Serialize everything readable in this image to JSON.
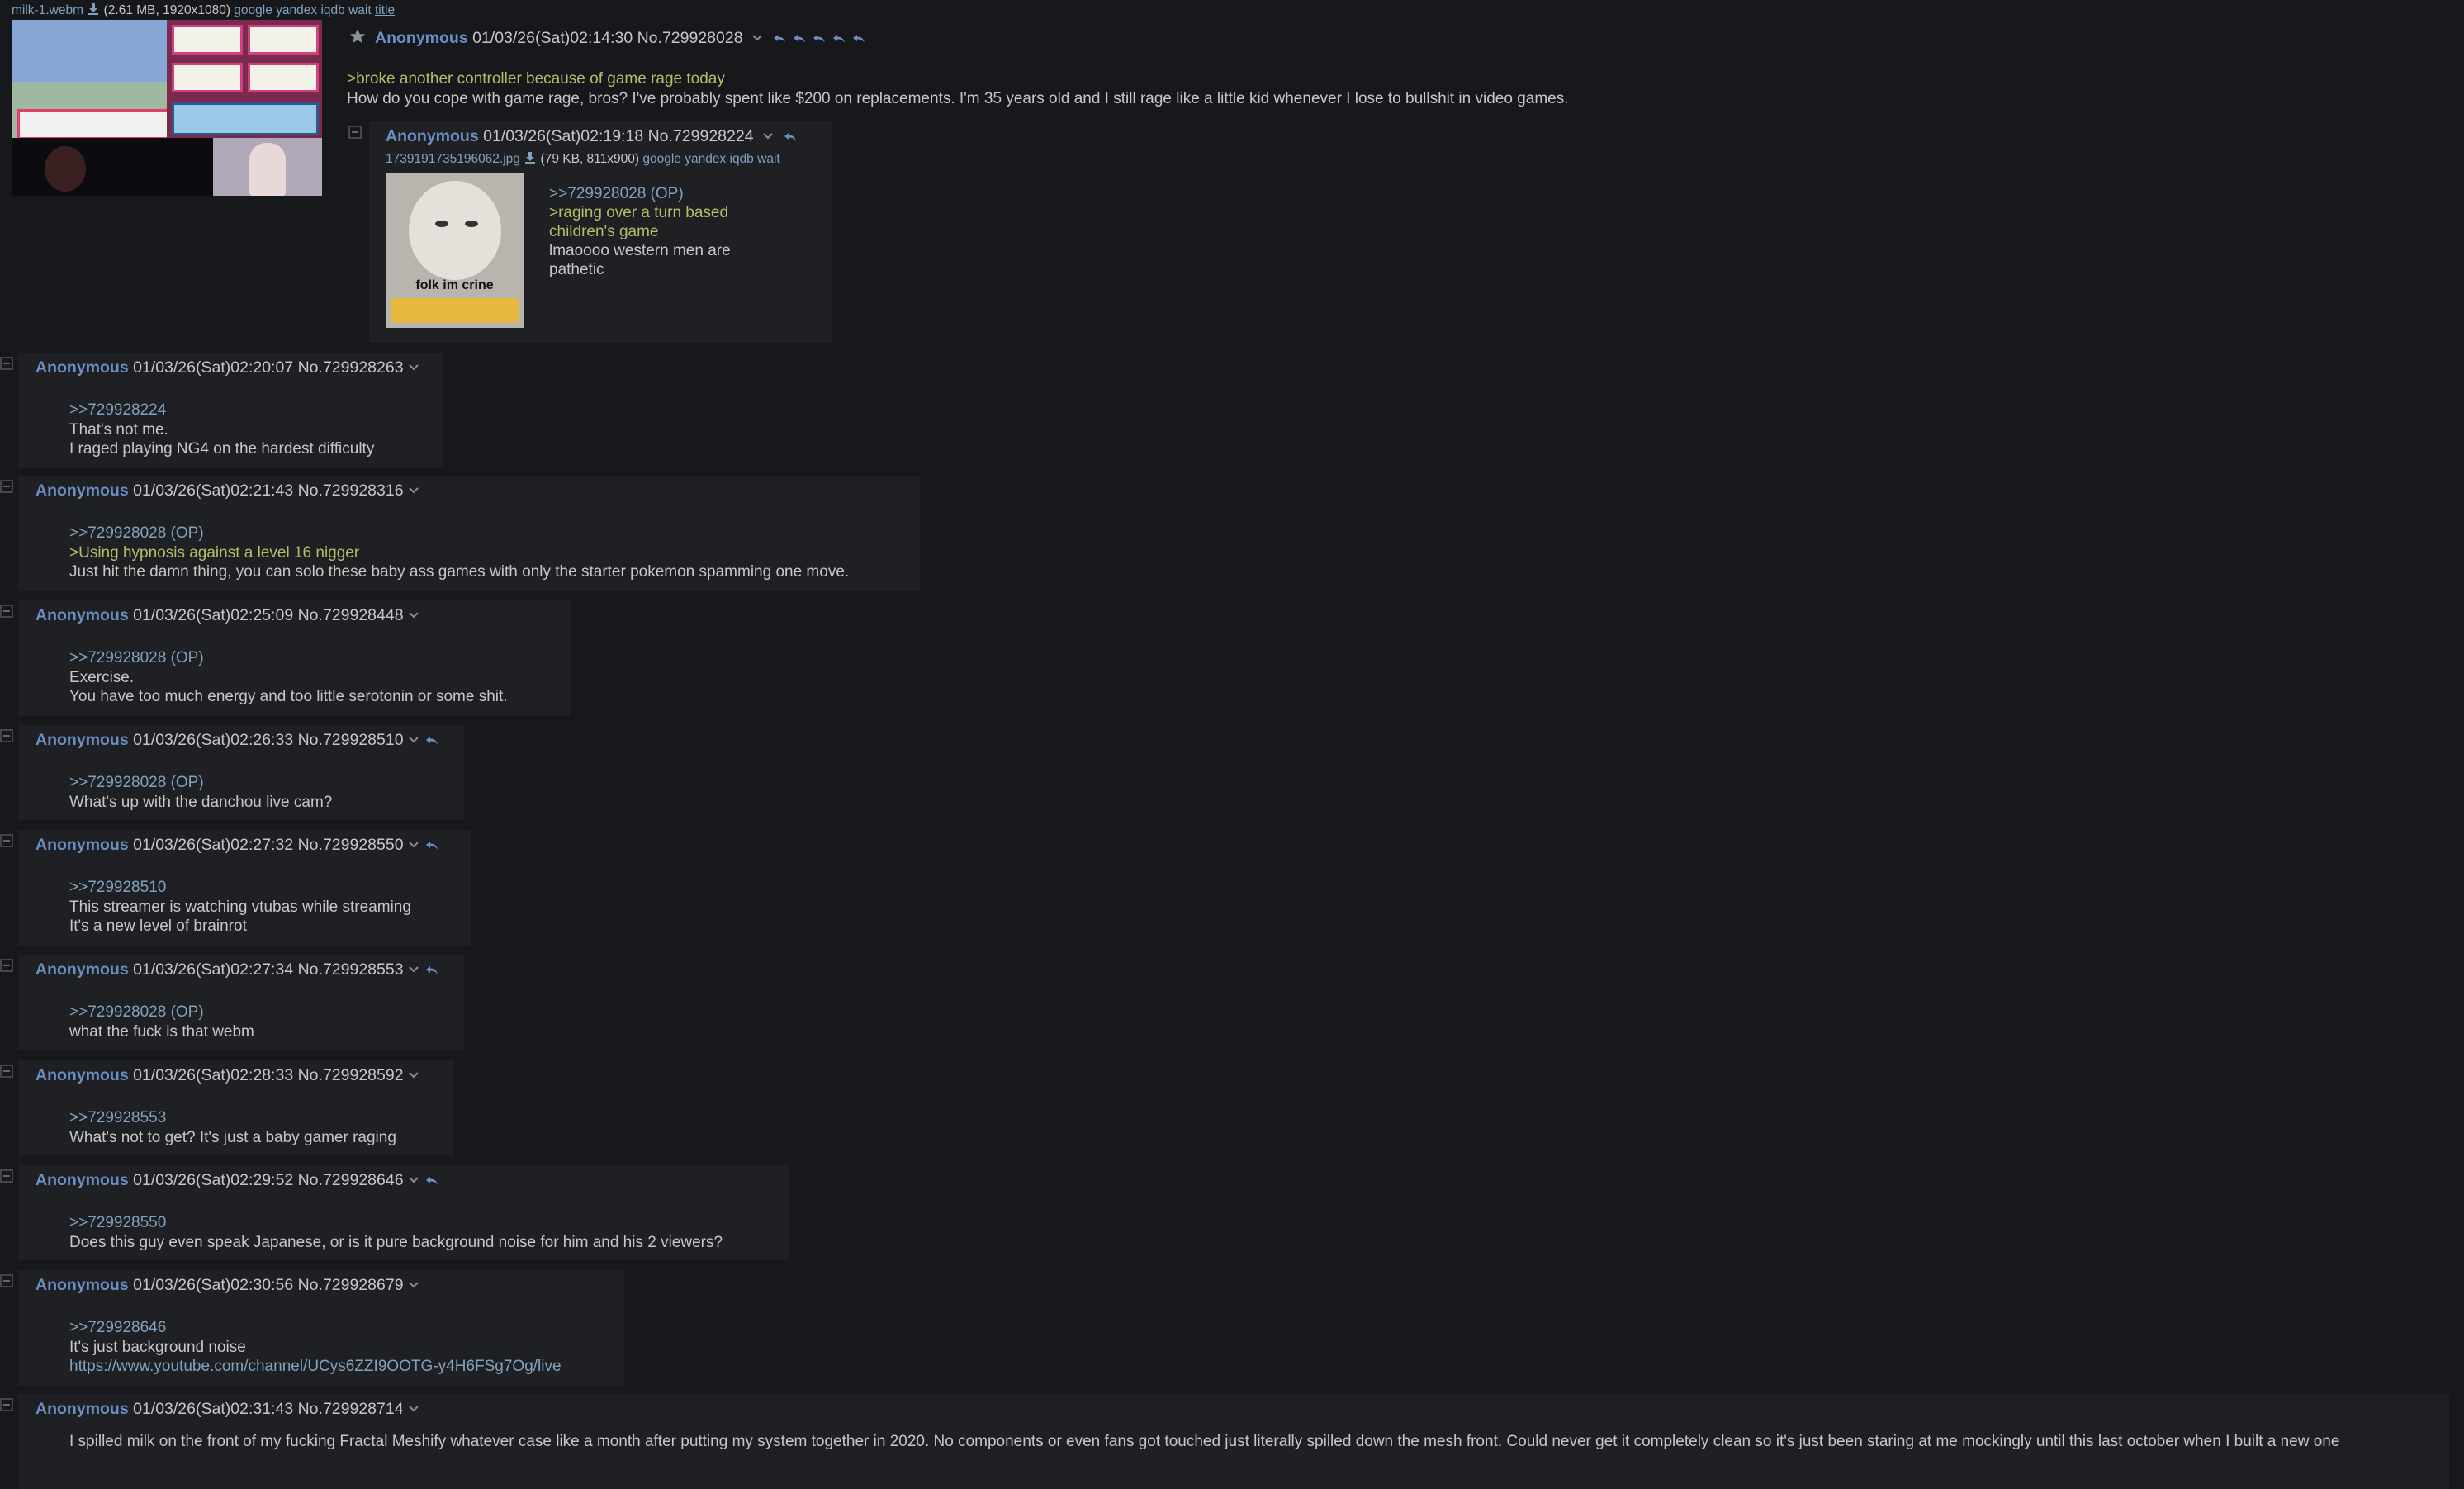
{
  "op": {
    "file": {
      "name": "milk-1.webm",
      "meta": "(2.61 MB, 1920x1080)",
      "services": [
        "google",
        "yandex",
        "iqdb",
        "wait"
      ],
      "title_link": "title"
    },
    "name": "Anonymous",
    "datetime": "01/03/26(Sat)02:14:30",
    "post_no": "No.729928028",
    "lines": [
      {
        "text": ">broke another controller because of game rage today",
        "kind": "quote"
      },
      {
        "text": "How do you cope with game rage, bros? I've probably spent like $200 on replacements. I'm 35 years old and I still rage like a little kid whenever I lose to bullshit in video games.",
        "kind": "text"
      }
    ]
  },
  "nested": {
    "name": "Anonymous",
    "datetime": "01/03/26(Sat)02:19:18",
    "post_no": "No.729928224",
    "file_name": "1739191735196062.jpg",
    "file_meta": "(79 KB, 811x900)",
    "services": [
      "google",
      "yandex",
      "iqdb",
      "wait"
    ],
    "thumb_caption": "folk im crine",
    "lines": [
      {
        "text": ">>729928028 (OP)",
        "kind": "link"
      },
      {
        "text": ">raging over a turn based",
        "kind": "quote"
      },
      {
        "text": "children's game",
        "kind": "quote"
      },
      {
        "text": "lmaoooo western men are",
        "kind": "text"
      },
      {
        "text": "pathetic",
        "kind": "text"
      }
    ]
  },
  "replies": [
    {
      "datetime": "01/03/26(Sat)02:20:07",
      "post_no": "No.729928263",
      "reply_icon": false,
      "lines": [
        {
          "text": ">>729928224",
          "kind": "link"
        },
        {
          "text": "That's not me.",
          "kind": "text"
        },
        {
          "text": "I raged playing NG4 on the hardest difficulty",
          "kind": "text"
        }
      ]
    },
    {
      "datetime": "01/03/26(Sat)02:21:43",
      "post_no": "No.729928316",
      "reply_icon": false,
      "lines": [
        {
          "text": ">>729928028 (OP)",
          "kind": "link"
        },
        {
          "text": ">Using hypnosis against a level 16 nigger",
          "kind": "quote"
        },
        {
          "text": "Just hit the damn thing, you can solo these baby ass games with only the starter pokemon spamming one move.",
          "kind": "text"
        }
      ]
    },
    {
      "datetime": "01/03/26(Sat)02:25:09",
      "post_no": "No.729928448",
      "reply_icon": false,
      "lines": [
        {
          "text": ">>729928028 (OP)",
          "kind": "link"
        },
        {
          "text": "Exercise.",
          "kind": "text"
        },
        {
          "text": "You have too much energy and too little serotonin or some shit.",
          "kind": "text"
        }
      ]
    },
    {
      "datetime": "01/03/26(Sat)02:26:33",
      "post_no": "No.729928510",
      "reply_icon": true,
      "lines": [
        {
          "text": ">>729928028 (OP)",
          "kind": "link"
        },
        {
          "text": "What's up with the danchou live cam?",
          "kind": "text"
        }
      ]
    },
    {
      "datetime": "01/03/26(Sat)02:27:32",
      "post_no": "No.729928550",
      "reply_icon": true,
      "lines": [
        {
          "text": ">>729928510",
          "kind": "link"
        },
        {
          "text": "This streamer is watching vtubas while streaming",
          "kind": "text"
        },
        {
          "text": "It's a new level of brainrot",
          "kind": "text"
        }
      ]
    },
    {
      "datetime": "01/03/26(Sat)02:27:34",
      "post_no": "No.729928553",
      "reply_icon": true,
      "lines": [
        {
          "text": ">>729928028 (OP)",
          "kind": "link"
        },
        {
          "text": "what the fuck is that webm",
          "kind": "text"
        }
      ]
    },
    {
      "datetime": "01/03/26(Sat)02:28:33",
      "post_no": "No.729928592",
      "reply_icon": false,
      "lines": [
        {
          "text": ">>729928553",
          "kind": "link"
        },
        {
          "text": "What's not to get? It's just a baby gamer raging",
          "kind": "text"
        }
      ]
    },
    {
      "datetime": "01/03/26(Sat)02:29:52",
      "post_no": "No.729928646",
      "reply_icon": true,
      "lines": [
        {
          "text": ">>729928550",
          "kind": "link"
        },
        {
          "text": "Does this guy even speak Japanese, or is it pure background noise for him and his 2 viewers?",
          "kind": "text"
        }
      ]
    },
    {
      "datetime": "01/03/26(Sat)02:30:56",
      "post_no": "No.729928679",
      "reply_icon": false,
      "lines": [
        {
          "text": ">>729928646",
          "kind": "link"
        },
        {
          "text": "It's just background noise",
          "kind": "text"
        },
        {
          "text": "https://www.youtube.com/channel/UCys6ZZI9OOTG-y4H6FSg7Og/live",
          "kind": "link"
        }
      ]
    },
    {
      "datetime": "01/03/26(Sat)02:31:43",
      "post_no": "No.729928714",
      "reply_icon": false,
      "lines": [
        {
          "text": "I spilled milk on the front of my fucking Fractal Meshify whatever case like a month after putting my system together in 2020. No components or even fans got touched just literally spilled down the mesh front. Could never get it completely clean so it's just been staring at me mockingly until this last october when I built a new one",
          "kind": "text"
        }
      ]
    }
  ],
  "reply_name": "Anonymous",
  "colors": {
    "background": "#17181c",
    "post_bg": "#1f2024",
    "name": "#6b8fc4",
    "link": "#81a2be",
    "quote": "#b5bd68",
    "text": "#c5c8c6"
  }
}
